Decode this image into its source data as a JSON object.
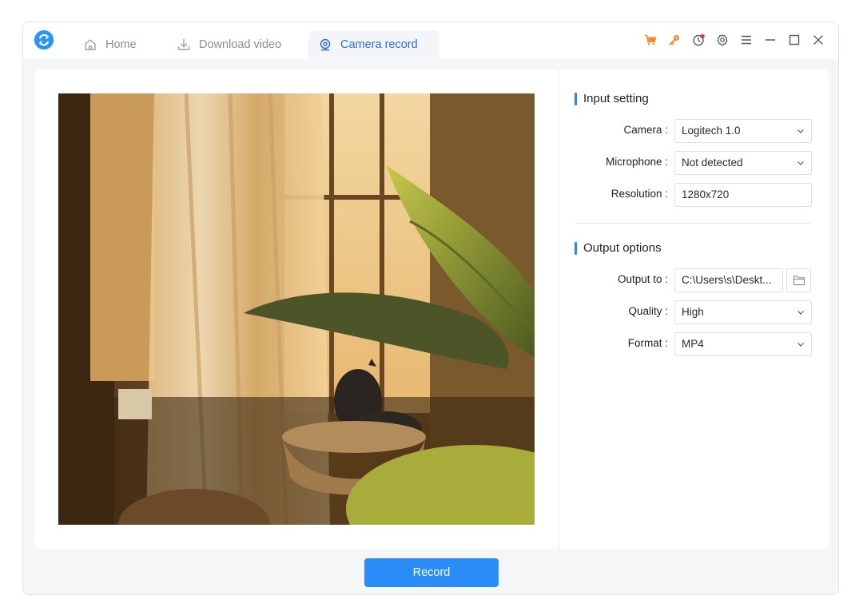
{
  "tabs": {
    "home": "Home",
    "download": "Download video",
    "camera": "Camera record"
  },
  "titlebar_icons": [
    "cart-icon",
    "key-icon",
    "history-icon",
    "gear-icon",
    "menu-icon",
    "minimize-icon",
    "maximize-icon",
    "close-icon"
  ],
  "colors": {
    "accent": "#2a8cf7",
    "active_tab_text": "#2d6fd6",
    "cart": "#f0872b",
    "key": "#f0872b",
    "badge": "#e8363d"
  },
  "input_setting": {
    "title": "Input setting",
    "camera_label": "Camera :",
    "camera_value": "Logitech 1.0",
    "microphone_label": "Microphone :",
    "microphone_value": "Not detected",
    "resolution_label": "Resolution :",
    "resolution_value": "1280x720"
  },
  "output_options": {
    "title": "Output options",
    "output_label": "Output to :",
    "output_value": "C:\\Users\\s\\Deskt...",
    "quality_label": "Quality :",
    "quality_value": "High",
    "format_label": "Format :",
    "format_value": "MP4"
  },
  "record_label": "Record"
}
